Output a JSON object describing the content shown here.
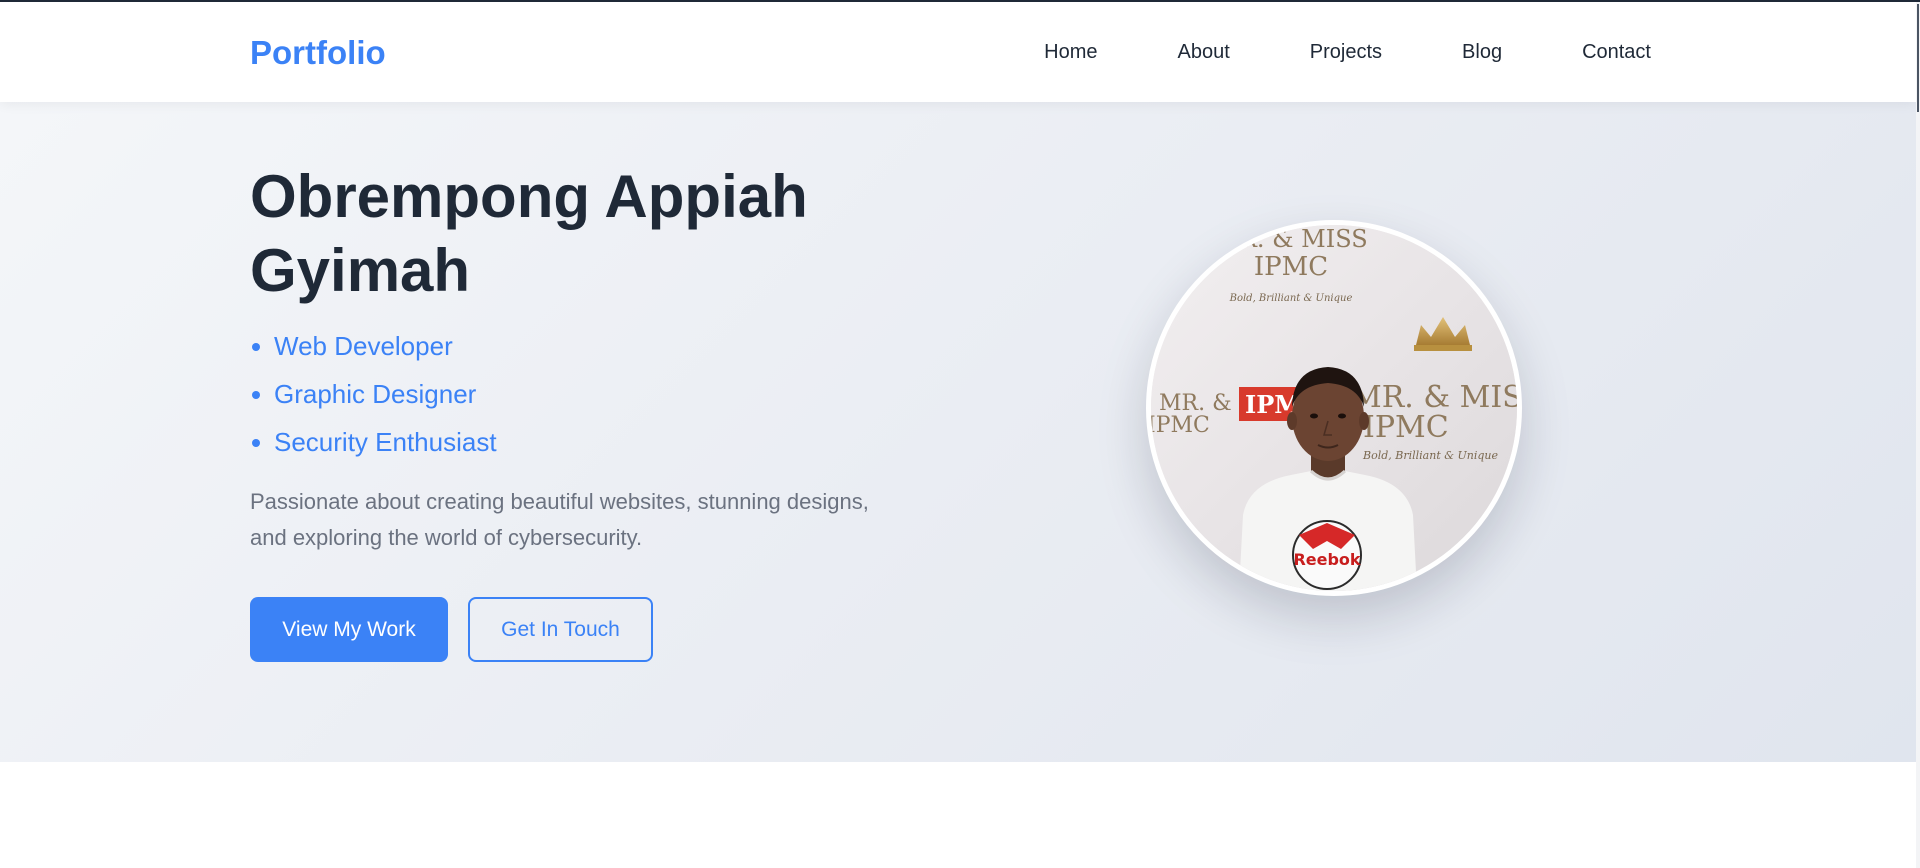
{
  "nav": {
    "brand": "Portfolio",
    "links": [
      "Home",
      "About",
      "Projects",
      "Blog",
      "Contact"
    ]
  },
  "hero": {
    "name": "Obrempong Appiah Gyimah",
    "roles": [
      "Web Developer",
      "Graphic Designer",
      "Security Enthusiast"
    ],
    "tagline": "Passionate about creating beautiful websites, stunning designs, and exploring the world of cybersecurity.",
    "primary_button": "View My Work",
    "secondary_button": "Get In Touch",
    "photo": {
      "backdrop_text_a": "MR. & MISS",
      "backdrop_text_b": "IPMC",
      "backdrop_script": "Bold, Brilliant & Unique",
      "red_badge": "IPM",
      "shirt_logo": "Reebok"
    }
  },
  "colors": {
    "accent": "#3b82f6",
    "heading": "#1f2937",
    "muted": "#6b7280"
  }
}
